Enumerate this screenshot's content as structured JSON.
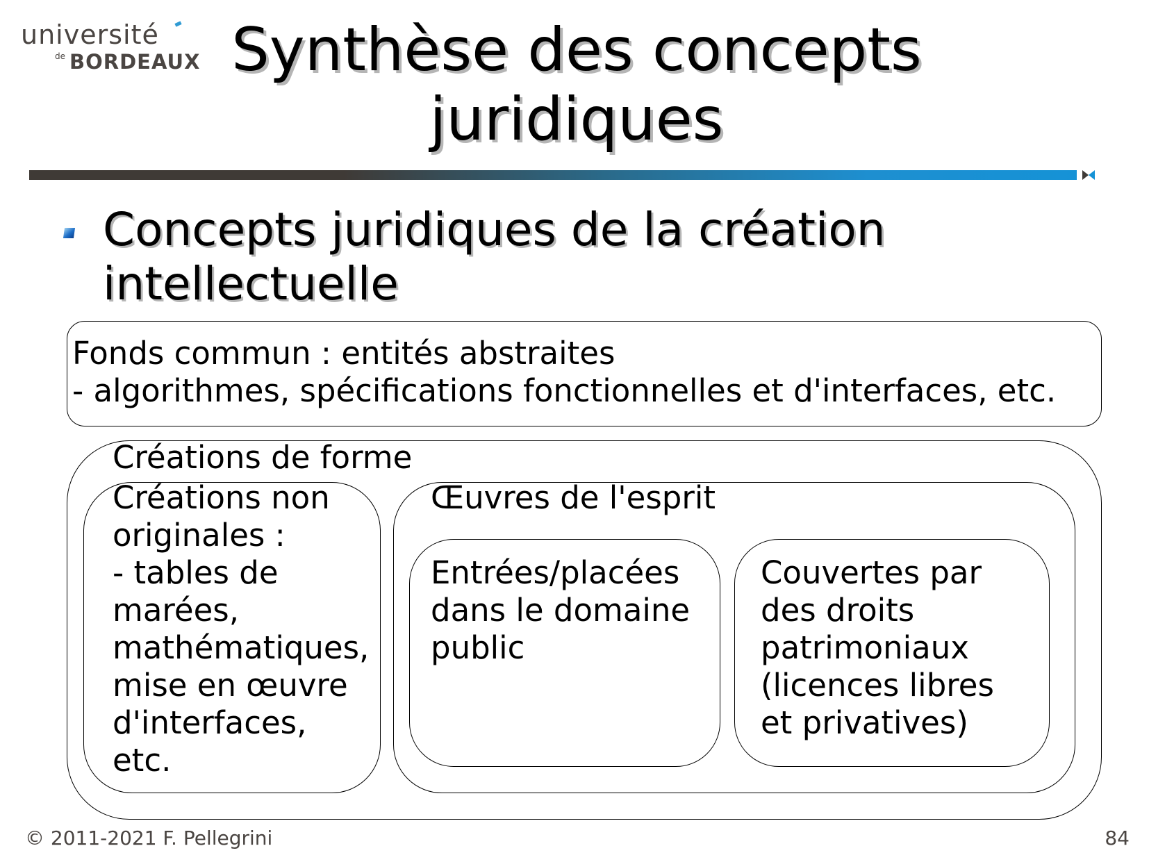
{
  "logo": {
    "line1": "université",
    "line2_prefix": "de",
    "line2": "BORDEAUX"
  },
  "title": "Synthèse des concepts juridiques",
  "bullet": "Concepts juridiques de la création intellectuelle",
  "diagram": {
    "fonds": "Fonds commun : entités abstraites\n- algorithmes, spécifications fonctionnelles et d'interfaces, etc.",
    "formes": "Créations de forme",
    "non_originales": "Créations non\noriginales :\n- tables de\nmarées,\nmathématiques,\nmise en œuvre\nd'interfaces,\netc.",
    "oeuvres": "Œuvres de l'esprit",
    "domaine_public": "Entrées/placées\ndans le domaine\npublic",
    "droits": "Couvertes par\ndes droits\npatrimoniaux\n(licences libres\net privatives)"
  },
  "footer": {
    "copyright": "© 2011-2021 F. Pellegrini",
    "page_number": "84"
  },
  "colors": {
    "rule_dark": "#3f3a36",
    "rule_blue": "#1592d6",
    "logo_text": "#4a4542"
  }
}
